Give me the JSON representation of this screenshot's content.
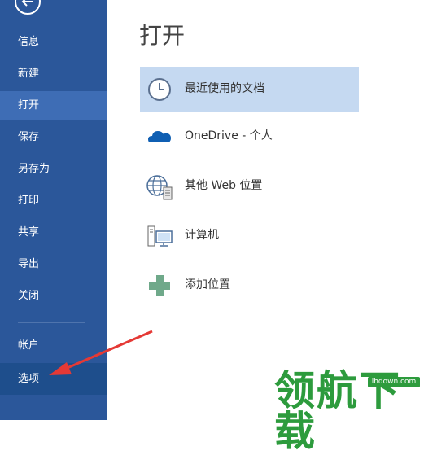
{
  "sidebar": {
    "items": [
      {
        "label": "信息"
      },
      {
        "label": "新建"
      },
      {
        "label": "打开"
      },
      {
        "label": "保存"
      },
      {
        "label": "另存为"
      },
      {
        "label": "打印"
      },
      {
        "label": "共享"
      },
      {
        "label": "导出"
      },
      {
        "label": "关闭"
      },
      {
        "label": "帐户"
      },
      {
        "label": "选项"
      }
    ],
    "active": "打开"
  },
  "main": {
    "title": "打开",
    "locations": [
      {
        "label": "最近使用的文档",
        "icon": "clock-icon",
        "selected": true
      },
      {
        "label": "OneDrive - 个人",
        "icon": "cloud-icon",
        "selected": false
      },
      {
        "label": "其他 Web 位置",
        "icon": "globe-server-icon",
        "selected": false
      },
      {
        "label": "计算机",
        "icon": "computer-icon",
        "selected": false
      },
      {
        "label": "添加位置",
        "icon": "plus-icon",
        "selected": false
      }
    ]
  },
  "watermark": {
    "text": "领航下载",
    "url": "lhdown.com"
  },
  "colors": {
    "sidebar": "#2b579a",
    "sidebar_active": "#3e6db5",
    "selected_location": "#c5d9f1",
    "watermark": "#2d9b3d",
    "arrow": "#e53935"
  }
}
